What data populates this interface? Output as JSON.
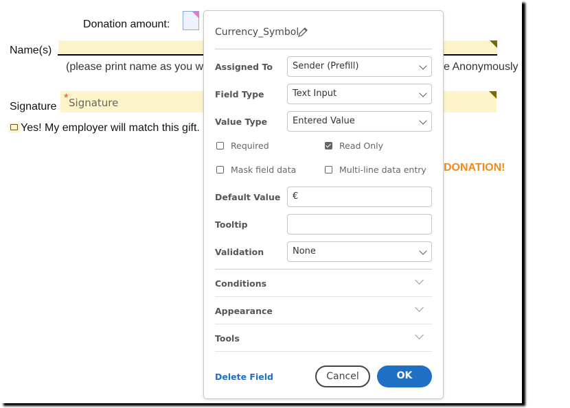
{
  "document": {
    "donation_label": "Donation amount:",
    "name_label": "Name(s)",
    "name_hint_left": "(please print name as you wou",
    "name_hint_right": "e Anonymously",
    "signature_label": "Signature",
    "signature_placeholder": "Signature",
    "required_mark": "*",
    "employer_match": "Yes!  My employer will match this gift.",
    "donation_banner": "DONATION!"
  },
  "dialog": {
    "title": "Currency_Symbol",
    "edit_icon": "pencil-icon",
    "fields": {
      "assigned_to": {
        "label": "Assigned To",
        "value": "Sender (Prefill)"
      },
      "field_type": {
        "label": "Field Type",
        "value": "Text Input"
      },
      "value_type": {
        "label": "Value Type",
        "value": "Entered Value"
      },
      "default_value": {
        "label": "Default Value",
        "value": "€"
      },
      "tooltip": {
        "label": "Tooltip",
        "value": ""
      },
      "validation": {
        "label": "Validation",
        "value": "None"
      }
    },
    "checkboxes": {
      "required": {
        "label": "Required",
        "checked": false
      },
      "read_only": {
        "label": "Read Only",
        "checked": true
      },
      "mask": {
        "label": "Mask field data",
        "checked": false
      },
      "multiline": {
        "label": "Multi-line data entry",
        "checked": false
      }
    },
    "sections": [
      "Conditions",
      "Appearance",
      "Tools"
    ],
    "delete_label": "Delete Field",
    "cancel_label": "Cancel",
    "ok_label": "OK",
    "colors": {
      "primary": "#1f6fc5",
      "link": "#1f6fc5",
      "field_fill": "#fdf5c9",
      "banner": "#f08a1c"
    }
  }
}
